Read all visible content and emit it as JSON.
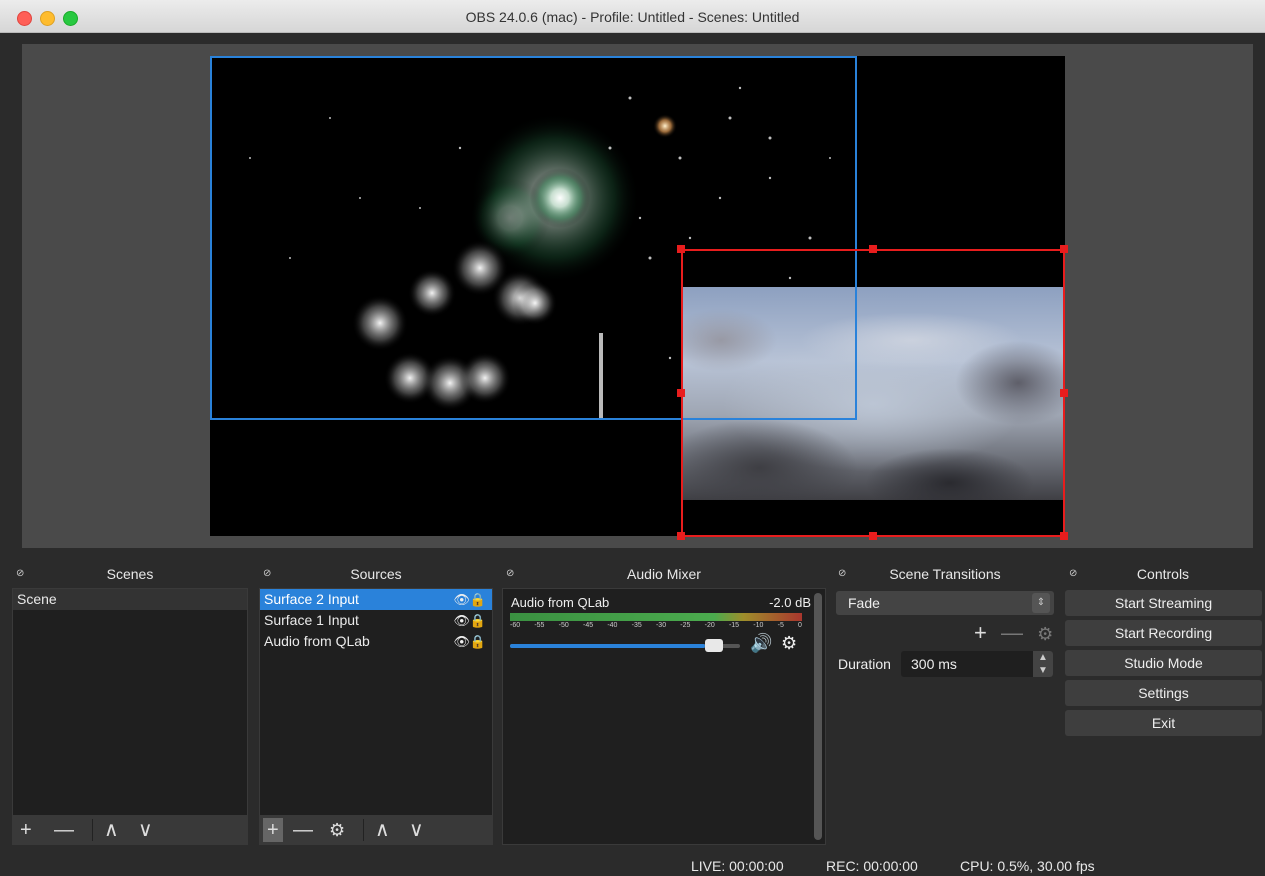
{
  "window": {
    "title": "OBS 24.0.6 (mac) - Profile: Untitled - Scenes: Untitled"
  },
  "preview": {
    "sources_shown": [
      "fireworks",
      "clouds"
    ],
    "selection_colors": {
      "primary": "#2a82da",
      "active": "#e81d1d"
    }
  },
  "docks": {
    "scenes": {
      "title": "Scenes",
      "items": [
        {
          "label": "Scene"
        }
      ],
      "toolbar": {
        "add": "+",
        "remove": "—",
        "up": "∧",
        "down": "∨"
      }
    },
    "sources": {
      "title": "Sources",
      "items": [
        {
          "label": "Surface 2 Input",
          "selected": true
        },
        {
          "label": "Surface 1 Input",
          "selected": false
        },
        {
          "label": "Audio from QLab",
          "selected": false
        }
      ],
      "toolbar": {
        "add": "+",
        "remove": "—",
        "settings": "⚙",
        "up": "∧",
        "down": "∨"
      }
    },
    "audio_mixer": {
      "title": "Audio Mixer",
      "tracks": [
        {
          "name": "Audio from QLab",
          "level_db": "-2.0 dB",
          "volume_fraction": 0.92
        }
      ],
      "scale": [
        "-60",
        "-55",
        "-50",
        "-45",
        "-40",
        "-35",
        "-30",
        "-25",
        "-20",
        "-15",
        "-10",
        "-5",
        "0"
      ]
    },
    "scene_transitions": {
      "title": "Scene Transitions",
      "selected_transition": "Fade",
      "duration_label": "Duration",
      "duration_value": "300 ms",
      "icons": {
        "add": "+",
        "remove": "—",
        "settings": "⚙"
      }
    },
    "controls": {
      "title": "Controls",
      "buttons": {
        "start_streaming": "Start Streaming",
        "start_recording": "Start Recording",
        "studio_mode": "Studio Mode",
        "settings": "Settings",
        "exit": "Exit"
      }
    }
  },
  "status_bar": {
    "live": "LIVE: 00:00:00",
    "rec": "REC: 00:00:00",
    "cpu": "CPU: 0.5%, 30.00 fps"
  },
  "colors": {
    "accent": "#2a82da",
    "background": "#2b2b2b",
    "panel": "#1f1f1f"
  }
}
